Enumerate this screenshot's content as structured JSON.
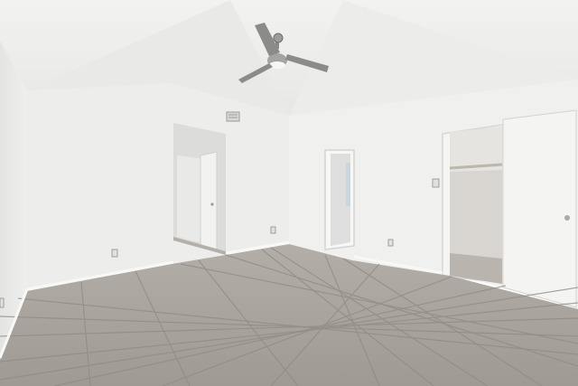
{
  "scene": {
    "description_kind": "photo-interior",
    "colors": {
      "wall": "#eeeeec",
      "wall_shadow": "#e2e2e0",
      "ceiling": "#efefed",
      "floor_tile": "#a8a39c",
      "grout": "#8e8981",
      "baseboard": "#f6f6f4",
      "door": "#f4f4f2",
      "closet_interior": "#d9d6d1"
    },
    "icons": [
      "ceiling-fan-icon",
      "outlet-icon",
      "light-switch-icon",
      "door-knob-icon",
      "ac-vent-icon"
    ]
  }
}
